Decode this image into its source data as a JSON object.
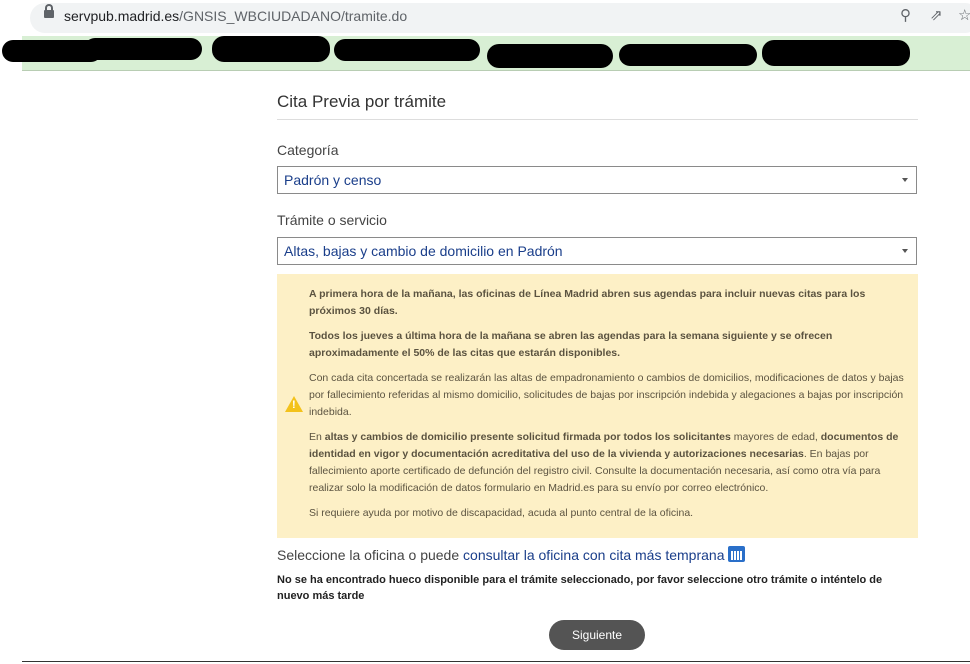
{
  "browser": {
    "url_domain": "servpub.madrid.es",
    "url_path": "/GNSIS_WBCIUDADANO/tramite.do",
    "zoom_icon": "magnifier-icon",
    "share_icon": "share-icon",
    "star_icon": "star-icon"
  },
  "page": {
    "title": "Cita Previa por trámite",
    "category_label": "Categoría",
    "category_value": "Padrón y censo",
    "service_label": "Trámite o servicio",
    "service_value": "Altas, bajas y cambio de domicilio en Padrón",
    "notice": {
      "p1": "A primera hora de la mañana, las oficinas de Línea Madrid abren sus agendas para incluir nuevas citas para los próximos 30 días.",
      "p2": "Todos los jueves a última hora de la mañana se abren las agendas para la semana siguiente y se ofrecen aproximadamente el 50% de las citas que estarán disponibles.",
      "p3": "Con cada cita concertada se realizarán las altas de empadronamiento o cambios de domicilios, modificaciones de datos y bajas por fallecimiento referidas al mismo domicilio, solicitudes de bajas por inscripción indebida y alegaciones a bajas por inscripción indebida.",
      "p4_a": "En ",
      "p4_b": "altas y cambios de domicilio presente solicitud firmada por todos los solicitantes",
      "p4_c": " mayores de edad, ",
      "p4_d": "documentos de identidad en vigor y documentación acreditativa del uso de la vivienda y autorizaciones necesarias",
      "p4_e": ". En bajas por fallecimiento aporte certificado de defunción del registro civil. Consulte la documentación necesaria, así como otra vía para realizar solo la modificación de datos formulario en Madrid.es para su envío por correo electrónico.",
      "p5": "Si requiere ayuda por motivo de discapacidad, acuda al punto central de la oficina."
    },
    "office_prefix": "Seleccione la oficina o puede ",
    "office_link": "consultar la oficina con cita más temprana",
    "no_slot_message": "No se ha encontrado hueco disponible para el trámite seleccionado, por favor seleccione otro trámite o inténtelo de nuevo más tarde",
    "next_button": "Siguiente"
  }
}
